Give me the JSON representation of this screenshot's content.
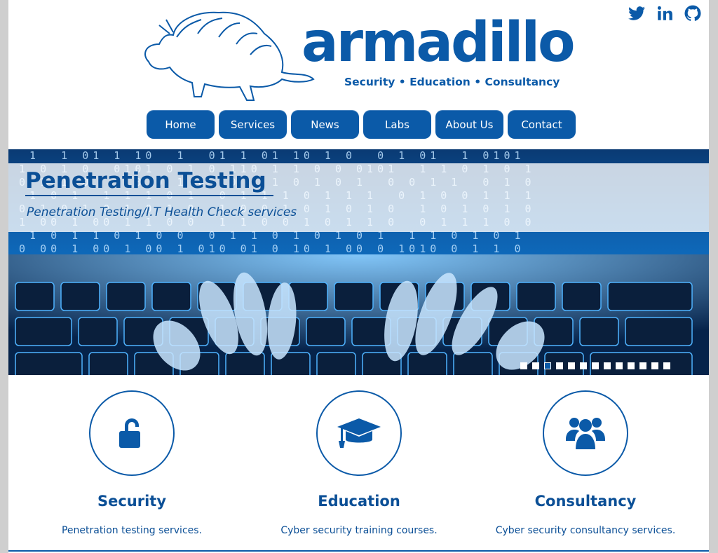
{
  "brand": {
    "name": "armadillo",
    "tagline": "Security • Education • Consultancy"
  },
  "social": [
    {
      "icon": "twitter-icon"
    },
    {
      "icon": "linkedin-icon"
    },
    {
      "icon": "github-icon"
    }
  ],
  "nav": {
    "items": [
      {
        "label": "Home"
      },
      {
        "label": "Services"
      },
      {
        "label": "News"
      },
      {
        "label": "Labs"
      },
      {
        "label": "About Us"
      },
      {
        "label": "Contact"
      }
    ]
  },
  "hero": {
    "title": "Penetration Testing",
    "subtitle": "Penetration Testing/I.T Health Check services",
    "slide_count": 13,
    "active_slide": 3
  },
  "features": [
    {
      "icon": "unlock-icon",
      "title": "Security",
      "desc": "Penetration testing services."
    },
    {
      "icon": "graduation-cap-icon",
      "title": "Education",
      "desc": "Cyber security training courses."
    },
    {
      "icon": "users-icon",
      "title": "Consultancy",
      "desc": "Cyber security consultancy services."
    }
  ],
  "colors": {
    "brand_blue": "#0b5aa8",
    "background": "#ffffff"
  }
}
